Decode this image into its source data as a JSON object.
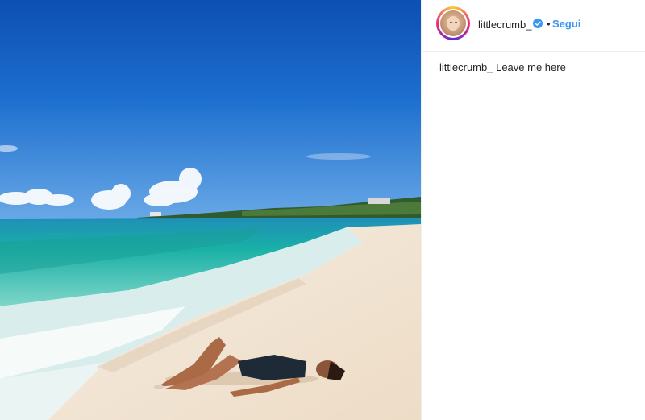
{
  "post": {
    "username": "littlecrumb_",
    "verified_icon": "verified-badge-icon",
    "separator": "•",
    "follow_label": "Segui",
    "follow_color": "#3897f0",
    "caption": {
      "username": "littlecrumb_",
      "text": "Leave me here"
    },
    "image_description": ""
  },
  "colors": {
    "sky": "#1463c4",
    "sea": "#1aa8a0",
    "sand": "#f2e3cf"
  }
}
